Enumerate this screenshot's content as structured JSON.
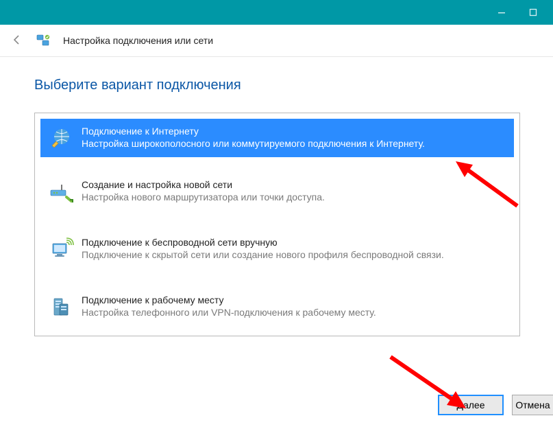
{
  "window": {
    "title": "Настройка подключения или сети"
  },
  "heading": "Выберите вариант подключения",
  "options": [
    {
      "title": "Подключение к Интернету",
      "desc": "Настройка широкополосного или коммутируемого подключения к Интернету.",
      "selected": true
    },
    {
      "title": "Создание и настройка новой сети",
      "desc": "Настройка нового маршрутизатора или точки доступа.",
      "selected": false
    },
    {
      "title": "Подключение к беспроводной сети вручную",
      "desc": "Подключение к скрытой сети или создание нового профиля беспроводной связи.",
      "selected": false
    },
    {
      "title": "Подключение к рабочему месту",
      "desc": "Настройка телефонного или VPN-подключения к рабочему месту.",
      "selected": false
    }
  ],
  "buttons": {
    "next": "Далее",
    "cancel": "Отмена"
  },
  "colors": {
    "titlebar": "#0098a6",
    "heading": "#0b57a6",
    "selection": "#2b8cff",
    "annotation": "#ff0000"
  }
}
